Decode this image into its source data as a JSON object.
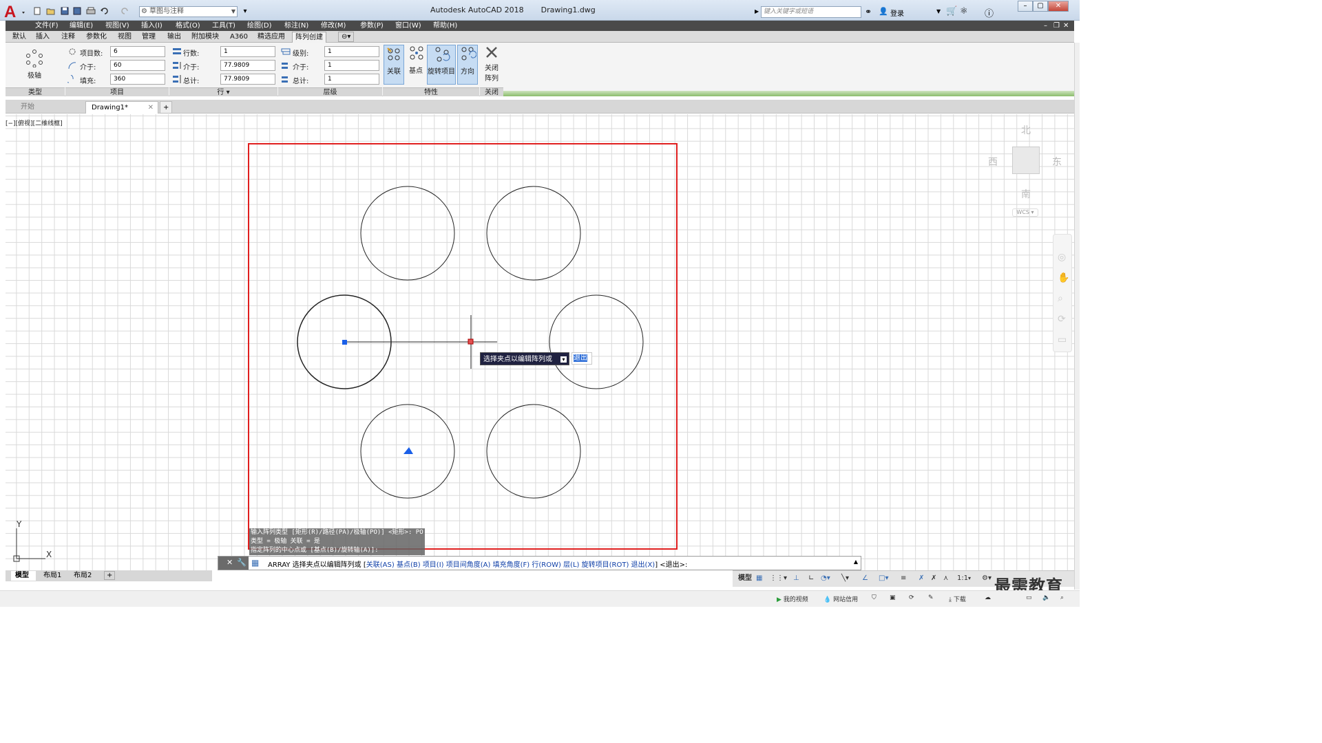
{
  "title": {
    "app_name": "Autodesk AutoCAD 2018",
    "file_name": "Drawing1.dwg",
    "workspace": "草图与注释",
    "search_placeholder": "键入关键字或短语",
    "login": "登录"
  },
  "menu": [
    "文件(F)",
    "编辑(E)",
    "视图(V)",
    "插入(I)",
    "格式(O)",
    "工具(T)",
    "绘图(D)",
    "标注(N)",
    "修改(M)",
    "参数(P)",
    "窗口(W)",
    "帮助(H)"
  ],
  "ribbon_tabs": [
    "默认",
    "插入",
    "注释",
    "参数化",
    "视图",
    "管理",
    "输出",
    "附加模块",
    "A360",
    "精选应用",
    "阵列创建"
  ],
  "ribbon": {
    "type_label": "极轴",
    "panels": {
      "type": "类型",
      "items": "项目",
      "rows": "行",
      "levels": "层级",
      "properties": "特性",
      "close": "关闭"
    },
    "items": {
      "count_label": "项目数:",
      "count_value": "6",
      "between_label": "介于:",
      "between_value": "60",
      "fill_label": "填充:",
      "fill_value": "360"
    },
    "rows": {
      "rows_label": "行数:",
      "rows_value": "1",
      "between_label": "介于:",
      "between_value": "77.9809",
      "total_label": "总计:",
      "total_value": "77.9809"
    },
    "levels": {
      "levels_label": "级别:",
      "levels_value": "1",
      "between_label": "介于:",
      "between_value": "1",
      "total_label": "总计:",
      "total_value": "1"
    },
    "properties": {
      "associative": "关联",
      "basepoint": "基点",
      "rotate_items": "旋转项目",
      "direction": "方向"
    },
    "close_array_line1": "关闭",
    "close_array_line2": "阵列"
  },
  "file_tabs": {
    "start": "开始",
    "drawing": "Drawing1*"
  },
  "viewport_label": "[−][俯视][二维线框]",
  "viewcube": {
    "north": "北",
    "south": "南",
    "east": "东",
    "west": "西",
    "wcs": "WCS"
  },
  "tooltip": {
    "text": "选择夹点以编辑阵列或",
    "input": "退出"
  },
  "command_history": [
    "输入阵列类型 [矩形(R)/路径(PA)/极轴(PO)] <矩形>: PO",
    "类型 = 极轴  关联 = 是",
    "指定阵列的中心点或 [基点(B)/旋转轴(A)]:"
  ],
  "command_line": {
    "prefix": "ARRAY 选择夹点以编辑阵列或 [",
    "options": [
      "关联(AS)",
      "基点(B)",
      "项目(I)",
      "项目间角度(A)",
      "填充角度(F)",
      "行(ROW)",
      "层(L)",
      "旋转项目(ROT)",
      "退出(X)"
    ],
    "suffix": "] <退出>:"
  },
  "layout_tabs": [
    "模型",
    "布局1",
    "布局2"
  ],
  "status": {
    "model": "模型",
    "scale": "1:1"
  },
  "taskbar": {
    "videos": "我的视频",
    "net": "网站信用",
    "download": "下载"
  },
  "watermark": "最需教育",
  "colors": {
    "selection_red": "#e01e1e",
    "grip_blue": "#1a5fe8",
    "menu_bg": "#4a4a4a",
    "active_button": "#c6dcf3"
  }
}
